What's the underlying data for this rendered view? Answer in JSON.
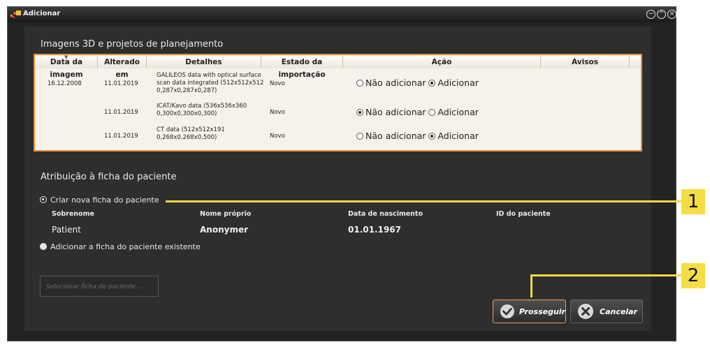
{
  "window": {
    "title": "Adicionar"
  },
  "images_section": {
    "title": "Imagens 3D e projetos de planejamento",
    "columns": [
      "Data da imagem",
      "Alterado em",
      "Detalhes",
      "Estado da importação",
      "Ação",
      "Avisos"
    ],
    "rows": [
      {
        "image_date": "16.12.2008",
        "changed": "11.01.2019",
        "details_line1": "GALILEOS data with optical surface",
        "details_line2": "scan data integrated (512x512x512",
        "details_line3": "0,287x0,287x0,287)",
        "status": "Novo",
        "action": "Adicionar"
      },
      {
        "image_date": "",
        "changed": "11.01.2019",
        "details_line1": "ICAT/Kavo data (536x536x360",
        "details_line2": "0,300x0,300x0,300)",
        "details_line3": "",
        "status": "Novo",
        "action": "Não adicionar"
      },
      {
        "image_date": "",
        "changed": "11.01.2019",
        "details_line1": "CT data (512x512x191",
        "details_line2": "0,268x0,268x0,500)",
        "details_line3": "",
        "status": "Novo",
        "action": "Adicionar"
      }
    ],
    "action_options": {
      "not_add": "Não adicionar",
      "add": "Adicionar"
    }
  },
  "assignment": {
    "title": "Atribuição à ficha do paciente",
    "option_new": "Criar nova ficha do paciente",
    "option_existing": "Adicionar a ficha do paciente existente",
    "selected": "new",
    "fields": {
      "surname_label": "Sobrenome",
      "surname": "Patient",
      "first_name_label": "Nome próprio",
      "first_name": "Anonymer",
      "birth_label": "Data de nascimento",
      "birth": "01.01.1967",
      "id_label": "ID do paciente",
      "id": ""
    },
    "select_button": "Selecionar ficha do paciente..."
  },
  "buttons": {
    "proceed": "Prosseguir",
    "cancel": "Cancelar"
  },
  "callouts": {
    "c1": "1",
    "c2": "2"
  },
  "colors": {
    "callout": "#f5dd45",
    "table_border": "#e88f3c",
    "window_bg": "#232323"
  }
}
